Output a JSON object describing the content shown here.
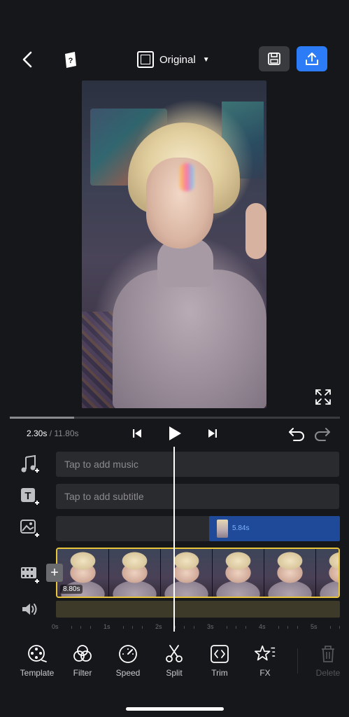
{
  "header": {
    "aspect_label": "Original",
    "colors": {
      "export_bg": "#2b7cf6",
      "save_bg": "#3a3b3f"
    }
  },
  "playback": {
    "current_time": "2.30s",
    "separator": "/",
    "total_time": "11.80s",
    "progress_fraction": 0.195
  },
  "tracks": {
    "music_placeholder": "Tap to add music",
    "subtitle_placeholder": "Tap to add subtitle",
    "overlay_duration": "5.84s",
    "video_duration": "8.80s"
  },
  "ruler": {
    "ticks": [
      "0s",
      "1s",
      "2s",
      "3s",
      "4s",
      "5s"
    ]
  },
  "toolbar": {
    "items": [
      {
        "label": "Template",
        "icon": "template-icon"
      },
      {
        "label": "Filter",
        "icon": "filter-icon"
      },
      {
        "label": "Speed",
        "icon": "speed-icon"
      },
      {
        "label": "Split",
        "icon": "scissors-icon"
      },
      {
        "label": "Trim",
        "icon": "trim-icon"
      },
      {
        "label": "FX",
        "icon": "fx-icon"
      },
      {
        "label": "Delete",
        "icon": "trash-icon"
      }
    ]
  },
  "colors": {
    "background": "#16171a",
    "clip_border": "#e9c53b",
    "overlay_clip": "#1f4a9a"
  }
}
